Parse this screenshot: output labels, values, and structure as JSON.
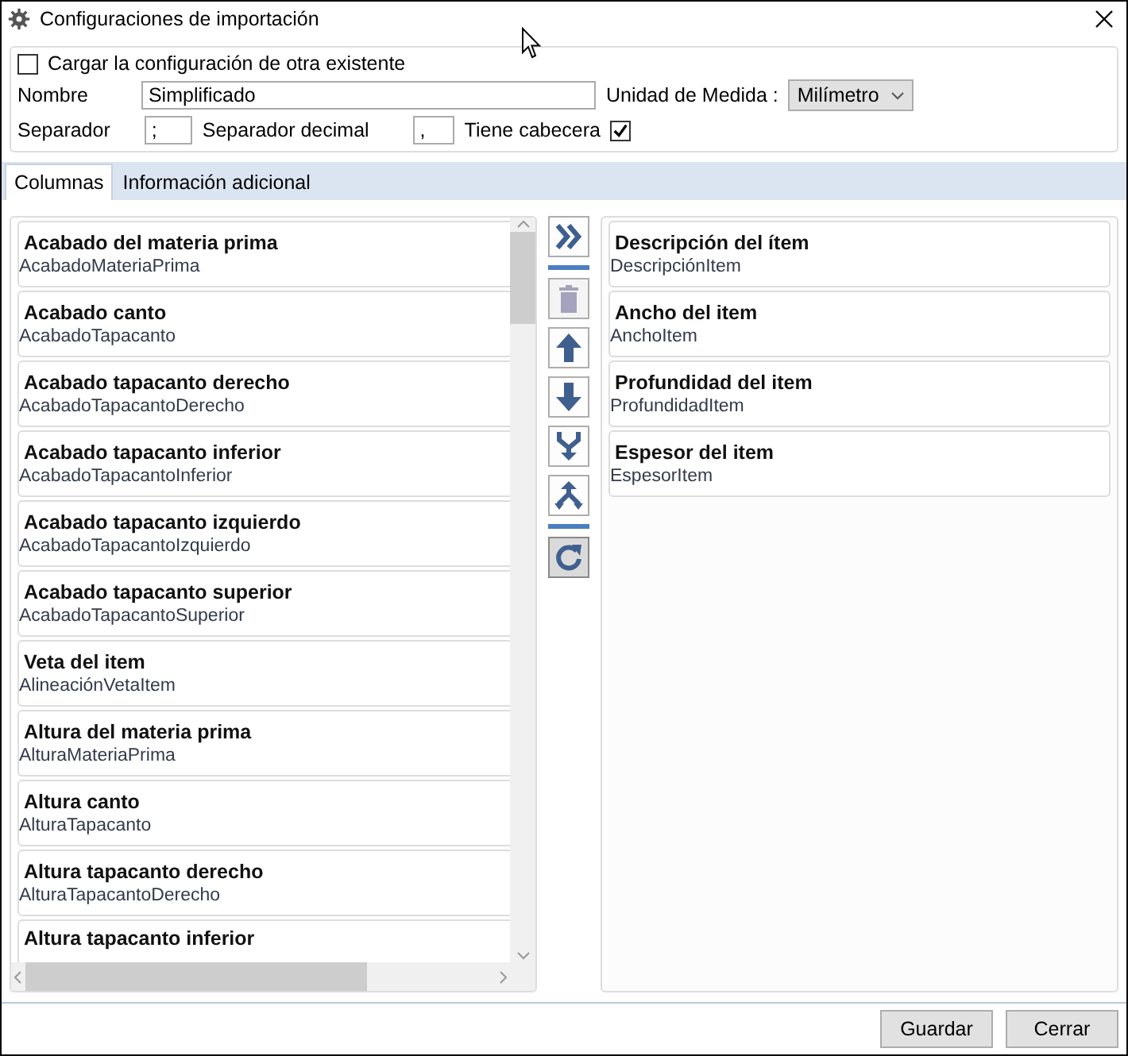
{
  "window": {
    "title": "Configuraciones de importación"
  },
  "load_existing": {
    "label": "Cargar la configuración de otra existente",
    "checked": false
  },
  "name_field": {
    "label": "Nombre",
    "value": "Simplificado"
  },
  "unit_field": {
    "label": "Unidad de Medida :",
    "value": "Milímetro"
  },
  "separator_field": {
    "label": "Separador",
    "value": ";"
  },
  "decimal_field": {
    "label": "Separador decimal",
    "value": ","
  },
  "has_header": {
    "label": "Tiene cabecera",
    "checked": true
  },
  "tabs": [
    {
      "label": "Columnas",
      "selected": true
    },
    {
      "label": "Información adicional",
      "selected": false
    }
  ],
  "available_columns": [
    {
      "title": "Acabado del materia prima",
      "field": "AcabadoMateriaPrima"
    },
    {
      "title": "Acabado canto",
      "field": "AcabadoTapacanto"
    },
    {
      "title": "Acabado tapacanto derecho",
      "field": "AcabadoTapacantoDerecho"
    },
    {
      "title": "Acabado tapacanto inferior",
      "field": "AcabadoTapacantoInferior"
    },
    {
      "title": "Acabado tapacanto izquierdo",
      "field": "AcabadoTapacantoIzquierdo"
    },
    {
      "title": "Acabado tapacanto superior",
      "field": "AcabadoTapacantoSuperior"
    },
    {
      "title": "Veta del item",
      "field": "AlineaciónVetaItem"
    },
    {
      "title": "Altura del materia prima",
      "field": "AlturaMateriaPrima"
    },
    {
      "title": "Altura canto",
      "field": "AlturaTapacanto"
    },
    {
      "title": "Altura tapacanto derecho",
      "field": "AlturaTapacantoDerecho"
    },
    {
      "title": "Altura tapacanto inferior"
    }
  ],
  "tool_buttons": [
    {
      "kind": "add_all",
      "disabled": false,
      "pressed": false
    },
    {
      "kind": "separator"
    },
    {
      "kind": "delete",
      "disabled": true,
      "pressed": false
    },
    {
      "kind": "move_up",
      "disabled": false,
      "pressed": false
    },
    {
      "kind": "move_down",
      "disabled": false,
      "pressed": false
    },
    {
      "kind": "merge",
      "disabled": false,
      "pressed": false
    },
    {
      "kind": "split",
      "disabled": false,
      "pressed": false
    },
    {
      "kind": "separator"
    },
    {
      "kind": "refresh",
      "disabled": false,
      "pressed": true
    }
  ],
  "selected_columns": [
    {
      "title": "Descripción del ítem",
      "field": "DescripciónItem"
    },
    {
      "title": "Ancho del item",
      "field": "AnchoItem"
    },
    {
      "title": "Profundidad del item",
      "field": "ProfundidadItem"
    },
    {
      "title": "Espesor del item",
      "field": "EspesorItem"
    }
  ],
  "buttons": [
    "Guardar",
    "Cerrar"
  ]
}
